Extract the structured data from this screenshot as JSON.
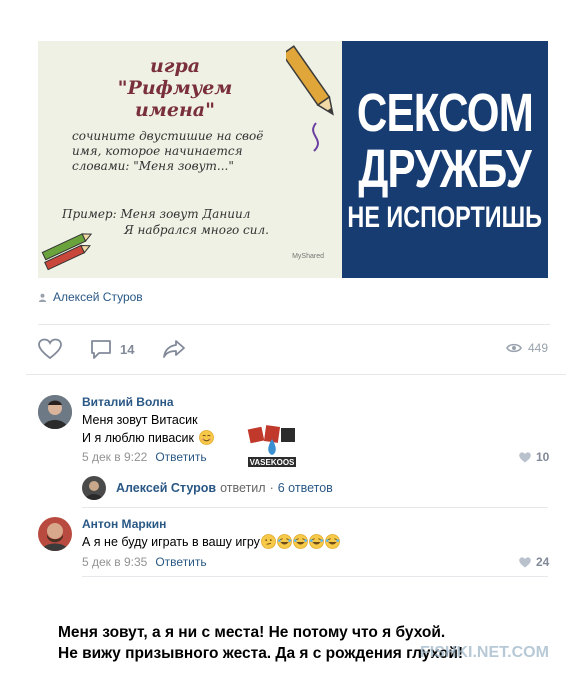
{
  "post": {
    "image_left": {
      "title": "игра \"Рифмуем имена\"",
      "instruction": "сочините двустишие на своё имя, которое начинается словами: \"Меня зовут...\"",
      "example_line1": "Пример: Меня зовут Даниил",
      "example_line2": "Я набрался много сил.",
      "watermark": "MyShared"
    },
    "image_right": {
      "line1": "СЕКСОМ",
      "line2": "ДРУЖБУ",
      "line3": "НЕ ИСПОРТИШЬ",
      "bg_color": "#173c72"
    },
    "author": "Алексей Стуров",
    "actions": {
      "like_icon": "heart-icon",
      "comment_icon": "comment-icon",
      "comment_count": "14",
      "share_icon": "share-icon",
      "views_icon": "eye-icon",
      "views_count": "449"
    }
  },
  "comments": [
    {
      "name": "Виталий Волна",
      "text_line1": "Меня зовут Витасик",
      "text_line2": "И я люблю пивасик",
      "date": "5 дек в 9:22",
      "reply_label": "Ответить",
      "likes": "10",
      "sticker_text": "VASEKOOS"
    },
    {
      "name": "Антон Маркин",
      "text": "А я не буду играть в вашу игру",
      "date": "5 дек в 9:35",
      "reply_label": "Ответить",
      "likes": "24"
    }
  ],
  "reply_thread": {
    "name": "Алексей Стуров",
    "verb": "ответил",
    "separator": "·",
    "count": "6 ответов"
  },
  "caption": {
    "line1": "Меня зовут, а я ни с места! Не потому что я бухой.",
    "line2": "Не вижу призывного жеста. Да я с рождения глухой!"
  },
  "watermark": "FISHKI.NET.COM",
  "colors": {
    "link": "#2a5885",
    "meta": "#939393",
    "icon": "#828a99"
  }
}
